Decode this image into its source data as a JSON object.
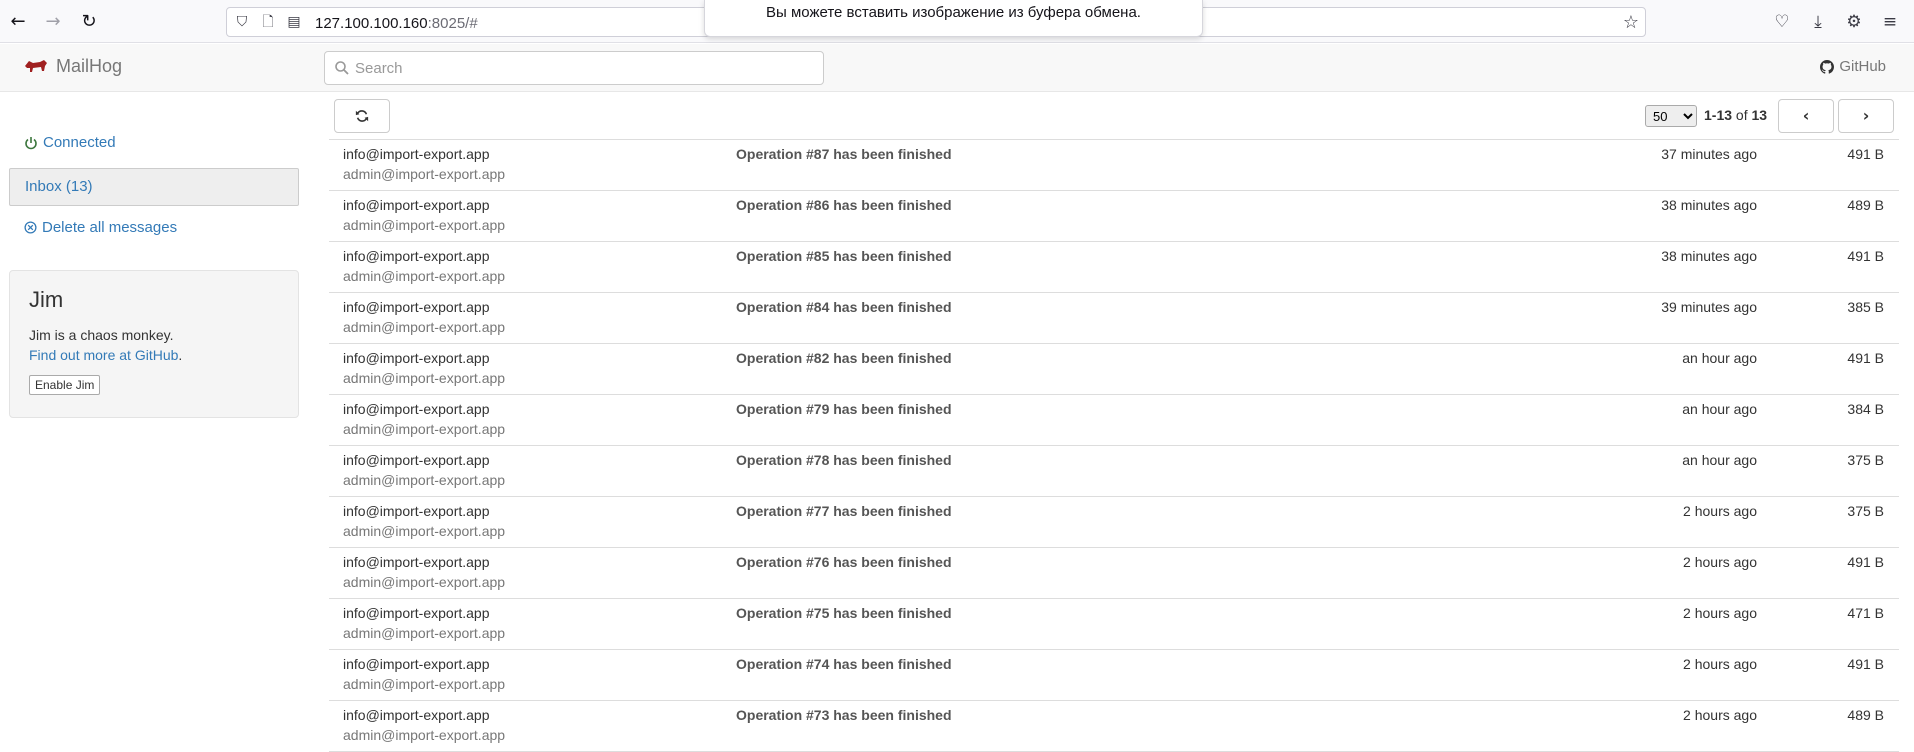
{
  "browser": {
    "url_host": "127.100.100.160",
    "url_rest": ":8025/#",
    "toast": "Вы можете вставить изображение из буфера обмена."
  },
  "app": {
    "brand": "MailHog",
    "search_placeholder": "Search",
    "github": "GitHub"
  },
  "sidebar": {
    "connected": "Connected",
    "inbox": "Inbox (13)",
    "delete_all": "Delete all messages",
    "jim": {
      "title": "Jim",
      "description": "Jim is a chaos monkey.",
      "link": "Find out more at GitHub",
      "link_suffix": ".",
      "button": "Enable Jim"
    }
  },
  "toolbar": {
    "page_size": "50",
    "range": "1-13",
    "of_label": "of",
    "total": "13"
  },
  "messages": [
    {
      "from": "info@import-export.app",
      "to": "admin@import-export.app",
      "subject": "Operation #87 has been finished",
      "time": "37 minutes ago",
      "size": "491 B"
    },
    {
      "from": "info@import-export.app",
      "to": "admin@import-export.app",
      "subject": "Operation #86 has been finished",
      "time": "38 minutes ago",
      "size": "489 B"
    },
    {
      "from": "info@import-export.app",
      "to": "admin@import-export.app",
      "subject": "Operation #85 has been finished",
      "time": "38 minutes ago",
      "size": "491 B"
    },
    {
      "from": "info@import-export.app",
      "to": "admin@import-export.app",
      "subject": "Operation #84 has been finished",
      "time": "39 minutes ago",
      "size": "385 B"
    },
    {
      "from": "info@import-export.app",
      "to": "admin@import-export.app",
      "subject": "Operation #82 has been finished",
      "time": "an hour ago",
      "size": "491 B"
    },
    {
      "from": "info@import-export.app",
      "to": "admin@import-export.app",
      "subject": "Operation #79 has been finished",
      "time": "an hour ago",
      "size": "384 B"
    },
    {
      "from": "info@import-export.app",
      "to": "admin@import-export.app",
      "subject": "Operation #78 has been finished",
      "time": "an hour ago",
      "size": "375 B"
    },
    {
      "from": "info@import-export.app",
      "to": "admin@import-export.app",
      "subject": "Operation #77 has been finished",
      "time": "2 hours ago",
      "size": "375 B"
    },
    {
      "from": "info@import-export.app",
      "to": "admin@import-export.app",
      "subject": "Operation #76 has been finished",
      "time": "2 hours ago",
      "size": "491 B"
    },
    {
      "from": "info@import-export.app",
      "to": "admin@import-export.app",
      "subject": "Operation #75 has been finished",
      "time": "2 hours ago",
      "size": "471 B"
    },
    {
      "from": "info@import-export.app",
      "to": "admin@import-export.app",
      "subject": "Operation #74 has been finished",
      "time": "2 hours ago",
      "size": "491 B"
    },
    {
      "from": "info@import-export.app",
      "to": "admin@import-export.app",
      "subject": "Operation #73 has been finished",
      "time": "2 hours ago",
      "size": "489 B"
    }
  ]
}
